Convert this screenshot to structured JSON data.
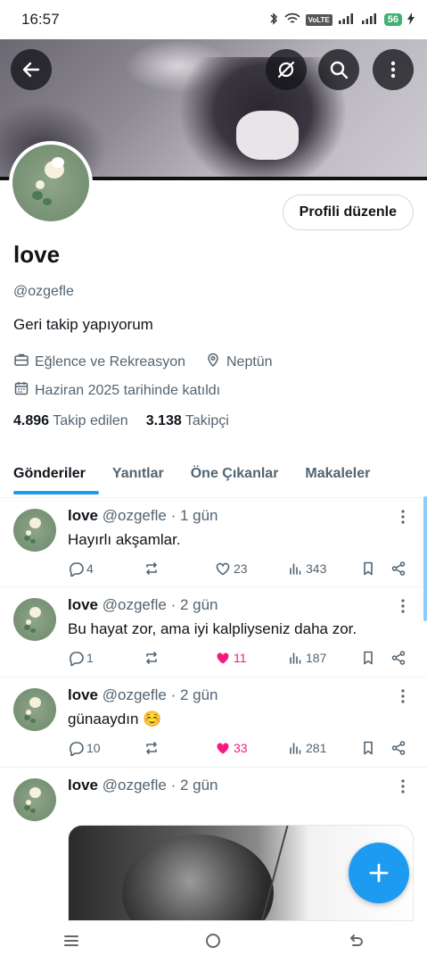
{
  "status_bar": {
    "time": "16:57",
    "volte": "VoLTE",
    "battery": "56"
  },
  "profile": {
    "name": "love",
    "handle": "@ozgefle",
    "bio": "Geri takip yapıyorum",
    "category": "Eğlence ve Rekreasyon",
    "location": "Neptün",
    "joined": "Haziran 2025 tarihinde katıldı",
    "following_count": "4.896",
    "following_label": "Takip edilen",
    "followers_count": "3.138",
    "followers_label": "Takipçi",
    "edit_button": "Profili düzenle"
  },
  "tabs": [
    "Gönderiler",
    "Yanıtlar",
    "Öne Çıkanlar",
    "Makaleler"
  ],
  "tweets": [
    {
      "name": "love",
      "handle": "@ozgefle",
      "time": "· 1 gün",
      "text": "Hayırlı akşamlar.",
      "replies": "4",
      "retweets": "",
      "likes": "23",
      "liked": false,
      "views": "343"
    },
    {
      "name": "love",
      "handle": "@ozgefle",
      "time": "· 2 gün",
      "text": "Bu hayat zor, ama iyi kalpliyseniz daha zor.",
      "replies": "1",
      "retweets": "",
      "likes": "11",
      "liked": true,
      "views": "187"
    },
    {
      "name": "love",
      "handle": "@ozgefle",
      "time": "· 2 gün",
      "text": "günaaydın ☺️",
      "replies": "10",
      "retweets": "",
      "likes": "33",
      "liked": true,
      "views": "281"
    },
    {
      "name": "love",
      "handle": "@ozgefle",
      "time": "· 2 gün",
      "text": ""
    }
  ],
  "colors": {
    "accent": "#1d9bf0",
    "like": "#f91880",
    "muted": "#536471",
    "text": "#0f1419"
  },
  "icons": {
    "back": "arrow-left-icon",
    "grok": "grok-icon",
    "search": "search-icon",
    "more": "more-vertical-icon",
    "compose": "plus-icon",
    "reply": "reply-icon",
    "retweet": "retweet-icon",
    "like": "heart-icon",
    "views": "views-icon",
    "bookmark": "bookmark-icon",
    "share": "share-icon"
  }
}
